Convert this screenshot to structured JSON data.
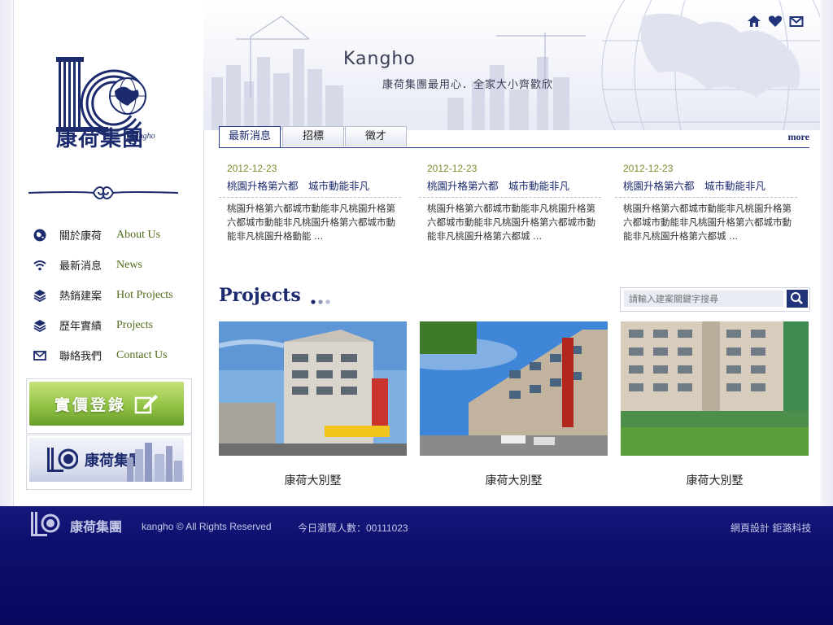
{
  "header": {
    "brand_en": "Kangho",
    "slogan": "康荷集團最用心．全家大小齊歡欣",
    "icons": [
      "home-icon",
      "heart-icon",
      "mail-icon"
    ]
  },
  "logo": {
    "cn": "康荷集團",
    "en": "Kangho"
  },
  "sidebar": {
    "nav": [
      {
        "cn": "關於康荷",
        "en": "About Us",
        "icon": "globe-icon"
      },
      {
        "cn": "最新消息",
        "en": "News",
        "icon": "wifi-icon"
      },
      {
        "cn": "熱銷建案",
        "en": "Hot Projects",
        "icon": "layers-icon"
      },
      {
        "cn": "歷年實績",
        "en": "Projects",
        "icon": "layers-icon"
      },
      {
        "cn": "聯絡我們",
        "en": "Contact Us",
        "icon": "mail-icon"
      }
    ],
    "banner_price": "實價登錄",
    "banner_brand": "康荷集團"
  },
  "tabs": {
    "items": [
      "最新消息",
      "招標",
      "徵才"
    ],
    "more": "more"
  },
  "news": [
    {
      "date": "2012-12-23",
      "title": "桃園升格第六都　城市動能非凡",
      "body": "桃園升格第六都城市動能非凡桃園升格第六都城市動能非凡桃園升格第六都城市動能非凡桃園升格動能 ..."
    },
    {
      "date": "2012-12-23",
      "title": "桃園升格第六都　城市動能非凡",
      "body": "桃園升格第六都城市動能非凡桃園升格第六都城市動能非凡桃園升格第六都城市動能非凡桃園升格第六都城 ..."
    },
    {
      "date": "2012-12-23",
      "title": "桃園升格第六都　城市動能非凡",
      "body": "桃園升格第六都城市動能非凡桃園升格第六都城市動能非凡桃園升格第六都城市動能非凡桃園升格第六都城 ..."
    }
  ],
  "projects": {
    "heading": "Projects",
    "search_placeholder": "請輸入建案關鍵字搜尋",
    "items": [
      {
        "name": "康荷大別墅"
      },
      {
        "name": "康荷大別墅"
      },
      {
        "name": "康荷大別墅"
      }
    ]
  },
  "footer": {
    "brand": "康荷集團",
    "copyright": "kangho ©  All Rights Reserved",
    "visitors": "今日瀏覽人數：00111023",
    "credit": "網頁設計 鉅潞科技"
  },
  "colors": {
    "navy": "#1c2a6e",
    "olive": "#4f6b1a",
    "footer": "#0d0f6d"
  }
}
